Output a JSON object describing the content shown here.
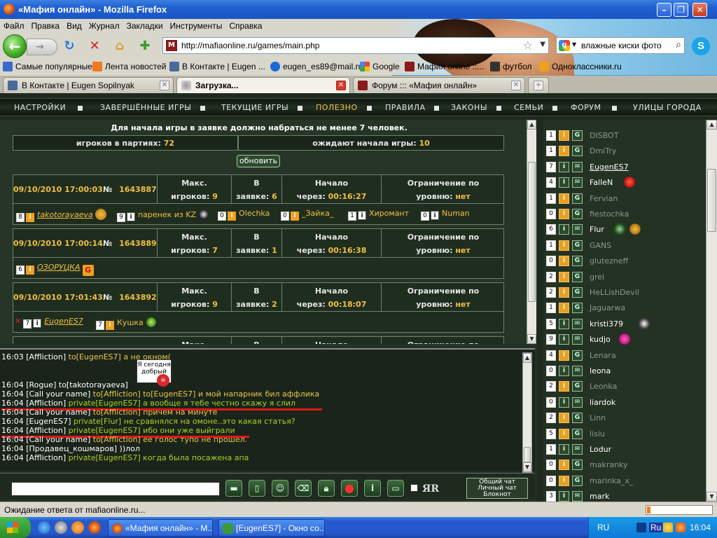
{
  "window": {
    "title": "«Мафия онлайн» - Mozilla Firefox"
  },
  "menu": [
    "Файл",
    "Правка",
    "Вид",
    "Журнал",
    "Закладки",
    "Инструменты",
    "Справка"
  ],
  "nav": {
    "url": "http://mafiaonline.ru/games/main.php",
    "search_query": "влажные киски фото"
  },
  "bookmarks": [
    "Самые популярные",
    "Лента новостей",
    "В Контакте | Eugen ...",
    "eugen_es89@mail.ru",
    "Google",
    "Мафия online ::...",
    "футбол",
    "Одноклассники.ru"
  ],
  "tabs": [
    {
      "label": "В Контакте | Eugen Sopilnyak"
    },
    {
      "label": "Загрузка..."
    },
    {
      "label": "Форум ::: «Мафия онлайн»"
    }
  ],
  "game_nav": [
    "НАСТРОЙКИ",
    "ЗАВЕРШЁННЫЕ ИГРЫ",
    "ТЕКУЩИЕ ИГРЫ",
    "ПОЛЕЗНО",
    "ПРАВИЛА",
    "ЗАКОНЫ",
    "СЕМЬИ",
    "ФОРУМ",
    "УЛИЦЫ ГОРОДА"
  ],
  "lobby": {
    "notice": "Для начала игры в заявке должно набраться не менее 7 человек.",
    "players_in_games_label": "игроков в партиях:",
    "players_in_games": "72",
    "waiting_label": "ожидают начала игры:",
    "waiting": "10",
    "refresh": "обновить"
  },
  "game_labels": {
    "num": "№",
    "max": "Макс.",
    "players": "игроков:",
    "in": "В",
    "request": "заявке:",
    "start": "Начало",
    "in_time": "через:",
    "limit": "Ограничение по",
    "level": "уровню:",
    "no": "нет"
  },
  "games": [
    {
      "date": "09/10/2010 17:00:03",
      "id": "1643887",
      "max": "9",
      "in_request": "6",
      "starts_in": "00:16:27",
      "players": [
        {
          "lvl": "8",
          "name": "takotorayaeva",
          "underline": true
        },
        {
          "lvl": "9",
          "name": "паренек из KZ",
          "underline": false
        },
        {
          "lvl": "0",
          "name": "Olechka",
          "underline": false
        },
        {
          "lvl": "0",
          "name": "_Зайка_",
          "underline": false
        },
        {
          "lvl": "1",
          "name": "Хиромант",
          "underline": false
        },
        {
          "lvl": "0",
          "name": "Numan",
          "underline": false
        }
      ]
    },
    {
      "date": "09/10/2010 17:00:14",
      "id": "1643889",
      "max": "7",
      "in_request": "1",
      "starts_in": "00:16:38",
      "players": [
        {
          "lvl": "6",
          "name": "ОЗОРУЦКА",
          "underline": true
        }
      ]
    },
    {
      "date": "09/10/2010 17:01:43",
      "id": "1643892",
      "max": "9",
      "in_request": "2",
      "starts_in": "00:18:07",
      "players": [
        {
          "lvl": "7",
          "name": "EugenES7",
          "underline": true
        },
        {
          "lvl": "7",
          "name": "Кушка",
          "underline": false
        }
      ]
    }
  ],
  "chat": {
    "sticker_text": "Я сегодня добрый",
    "lines": [
      {
        "t": "16:03",
        "who": "[Affliction]",
        "to": "to[EugenES7]",
        "msg": " а не окном(",
        "kind": "to"
      },
      {
        "t": "16:04",
        "who": "[Rogue]",
        "to": "to[takotorayaeva]",
        "msg": "",
        "kind": "plain"
      },
      {
        "t": "16:04",
        "who": "[Call your name]",
        "to": "to[Affliction] to[EugenES7]",
        "msg": " и мой напарник бил аффлика",
        "kind": "to"
      },
      {
        "t": "16:04",
        "who": "[Affliction]",
        "to": "private[EugenES7]",
        "msg": " а вообще я тебе честно скажу я слил",
        "kind": "private"
      },
      {
        "t": "16:04",
        "who": "[Call your name]",
        "to": "to[Affliction]",
        "msg": " причем на минуте",
        "kind": "to"
      },
      {
        "t": "16:04",
        "who": "[EugenES7]",
        "to": "private[Flur]",
        "msg": " не сравнялся на омоне..это какая статья?",
        "kind": "private"
      },
      {
        "t": "16:04",
        "who": "[Affliction]",
        "to": "private[EugenES7]",
        "msg": " ибо они уже выйграли",
        "kind": "private"
      },
      {
        "t": "16:04",
        "who": "[Call your name]",
        "to": "to[Affliction]",
        "msg": " ее голос тупо не прошел.",
        "kind": "to"
      },
      {
        "t": "16:04",
        "who": "[Продавец_кошмаров]",
        "to": "",
        "msg": " ))лол",
        "kind": "plain"
      },
      {
        "t": "16:04",
        "who": "[Affliction]",
        "to": "private[EugenES7]",
        "msg": " когда была посажена апа",
        "kind": "private"
      }
    ],
    "input_value": "",
    "mode_general": "Общий чат",
    "mode_private": "Личный чат",
    "mode_notes": "Блокнот",
    "yr_label": "ЯR"
  },
  "players_list": [
    {
      "lvl": "1",
      "name": "DISBOT",
      "state": "off"
    },
    {
      "lvl": "1",
      "name": "DmiTry",
      "state": "off"
    },
    {
      "lvl": "7",
      "name": "EugenES7",
      "state": "me"
    },
    {
      "lvl": "4",
      "name": "FalleN",
      "state": "on"
    },
    {
      "lvl": "1",
      "name": "Fervian",
      "state": "off"
    },
    {
      "lvl": "0",
      "name": "fiestochka",
      "state": "off"
    },
    {
      "lvl": "6",
      "name": "Flur",
      "state": "on"
    },
    {
      "lvl": "1",
      "name": "GANS",
      "state": "off"
    },
    {
      "lvl": "0",
      "name": "glutezneff",
      "state": "off"
    },
    {
      "lvl": "2",
      "name": "grei",
      "state": "off"
    },
    {
      "lvl": "2",
      "name": "HeLLishDevil",
      "state": "off"
    },
    {
      "lvl": "1",
      "name": "Jaguarwa",
      "state": "off"
    },
    {
      "lvl": "5",
      "name": "kristi379",
      "state": "on"
    },
    {
      "lvl": "9",
      "name": "kudjo",
      "state": "on"
    },
    {
      "lvl": "4",
      "name": "Lenara",
      "state": "off"
    },
    {
      "lvl": "0",
      "name": "leona",
      "state": "on"
    },
    {
      "lvl": "2",
      "name": "Leonka",
      "state": "off"
    },
    {
      "lvl": "0",
      "name": "liardok",
      "state": "on"
    },
    {
      "lvl": "2",
      "name": "Linn",
      "state": "off"
    },
    {
      "lvl": "5",
      "name": "lisiu",
      "state": "off"
    },
    {
      "lvl": "1",
      "name": "Lodur",
      "state": "on"
    },
    {
      "lvl": "0",
      "name": "makranky",
      "state": "off"
    },
    {
      "lvl": "0",
      "name": "marinka_x_",
      "state": "off"
    },
    {
      "lvl": "3",
      "name": "mark",
      "state": "on"
    }
  ],
  "status": {
    "text": "Ожидание ответа от mafiaonline.ru...",
    "progress": 0.05
  },
  "taskbar": {
    "start": "",
    "tasks": [
      "«Мафия онлайн» - M...",
      "[EugenES7] - Окно со..."
    ],
    "lang1": "RU",
    "lang2": "Ru",
    "clock": "16:04"
  }
}
